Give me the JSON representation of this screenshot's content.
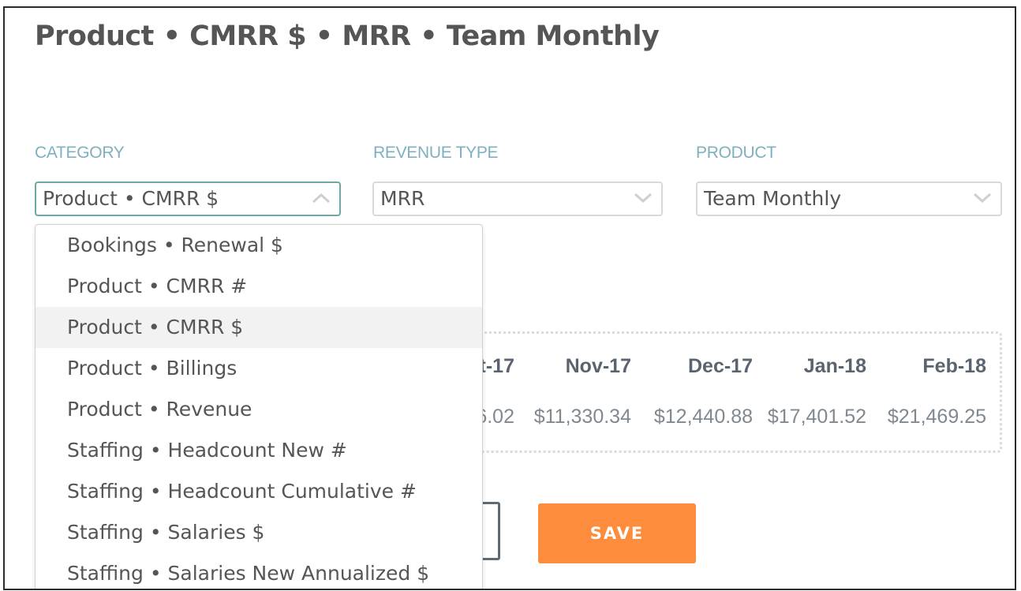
{
  "title": "Product • CMRR $ • MRR • Team Monthly",
  "fields": {
    "category": {
      "label": "CATEGORY",
      "value": "Product • CMRR $"
    },
    "revenue_type": {
      "label": "REVENUE TYPE",
      "value": "MRR"
    },
    "product": {
      "label": "PRODUCT",
      "value": "Team Monthly"
    }
  },
  "dropdown": {
    "options": [
      "Bookings • Renewal $",
      "Product • CMRR #",
      "Product • CMRR $",
      "Product • Billings",
      "Product • Revenue",
      "Staffing • Headcount New #",
      "Staffing • Headcount Cumulative #",
      "Staffing • Salaries $",
      "Staffing • Salaries New Annualized $"
    ],
    "highlighted_index": 2
  },
  "table": {
    "headers": [
      "t-17",
      "Nov-17",
      "Dec-17",
      "Jan-18",
      "Feb-18"
    ],
    "values": [
      "6.02",
      "$11,330.34",
      "$12,440.88",
      "$17,401.52",
      "$21,469.25"
    ]
  },
  "buttons": {
    "save": "SAVE"
  },
  "colors": {
    "accent": "#fd8c3c",
    "label": "#7fb0bd",
    "focus_border": "#6fa8a0"
  }
}
